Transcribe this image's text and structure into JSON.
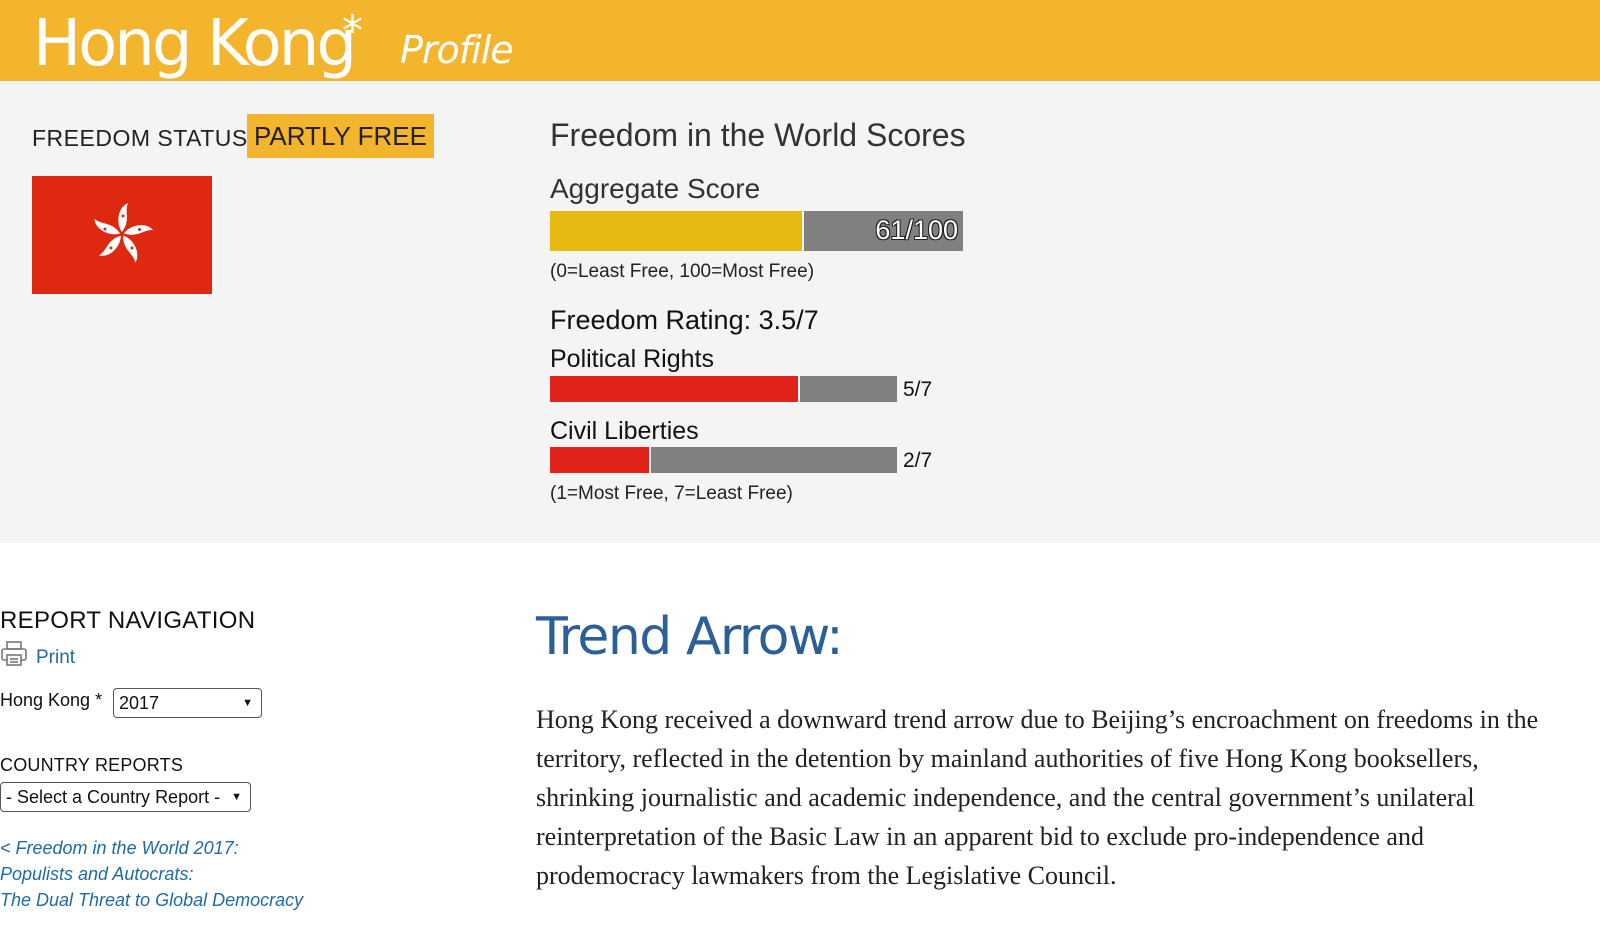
{
  "header": {
    "country": "Hong Kong",
    "asterisk": "*",
    "subtitle": "Profile",
    "color": "#f4b52e"
  },
  "status": {
    "label": "FREEDOM STATUS:",
    "value": "PARTLY FREE"
  },
  "flag": {
    "icon": "bauhinia-flag-icon",
    "color": "#de2910"
  },
  "scores": {
    "title": "Freedom in the World Scores",
    "aggregate": {
      "label": "Aggregate Score",
      "value": 61,
      "max": 100,
      "value_text": "61/100",
      "note": "(0=Least Free, 100=Most Free)"
    },
    "rating_title": "Freedom Rating: 3.5/7",
    "political_rights": {
      "label": "Political Rights",
      "value": 5,
      "max": 7,
      "value_text": "5/7"
    },
    "civil_liberties": {
      "label": "Civil Liberties",
      "value": 2,
      "max": 7,
      "value_text": "2/7"
    },
    "rating_note": "(1=Most Free, 7=Least Free)"
  },
  "nav": {
    "title": "REPORT NAVIGATION",
    "print_label": "Print",
    "year_label": "Hong Kong *",
    "year_selected": "2017",
    "country_reports_label": "COUNTRY REPORTS",
    "country_report_selected": "- Select a Country Report -",
    "back_link": {
      "line1": "< Freedom in the World 2017:",
      "line2": "Populists and Autocrats:",
      "line3": "The Dual Threat to Global Democracy"
    }
  },
  "main": {
    "trend_title": "Trend Arrow:",
    "trend_text": "Hong Kong received a downward trend arrow due to Beijing’s encroachment on freedoms in the territory, reflected in the detention by mainland authorities of five Hong Kong booksellers, shrinking journalistic and academic independence, and the central government’s unilateral reinterpretation of the Basic Law in an apparent bid to exclude pro-independence and prodemocracy lawmakers from the Legislative Council."
  }
}
